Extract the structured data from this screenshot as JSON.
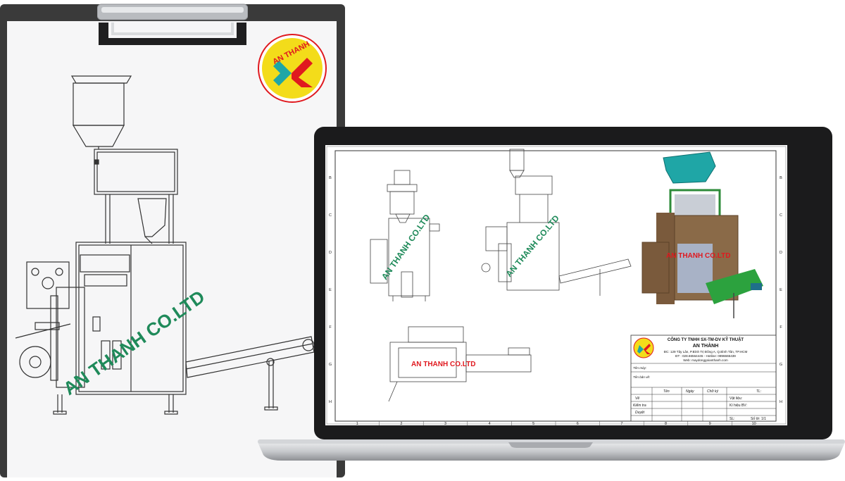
{
  "logo": {
    "text": "AN THANH"
  },
  "watermark": "AN THANH CO.LTD",
  "drawing": {
    "row_labels": [
      "B",
      "C",
      "D",
      "E",
      "F",
      "G",
      "H"
    ],
    "col_labels": [
      "1",
      "2",
      "3",
      "4",
      "5",
      "6",
      "7",
      "8",
      "9",
      "10"
    ]
  },
  "title_block": {
    "company": "CÔNG TY TNHH SX-TM-DV KỸ THUẬT",
    "company_name": "AN THÀNH",
    "address": "ĐC: 129 Tây Lân, P.Bình Trị Đông A, Q.Bình Tân, TP.HCM",
    "phone": "ĐT : 028.66564445 - Hotline: 0896665439",
    "web": "Web: maydonggoianthanh.com",
    "ten_may": "Tên máy:",
    "ten_ban_ve": "Tên bản vẽ:",
    "headers": [
      "Tên",
      "Ngày",
      "Chữ ký",
      "TL:"
    ],
    "rows": [
      "Vẽ",
      "Kiểm tra",
      "Duyệt"
    ],
    "vat_lieu": "Vật liệu:",
    "ki_hieu": "Kí hiệu BV:",
    "sl": "SL:",
    "so_to": "Số tờ: 1/1"
  },
  "colors": {
    "watermark_green": "#1f8a5a",
    "watermark_red": "#e0191f",
    "logo_yellow": "#f3dc1a",
    "hopper_teal": "#1fa6a6",
    "frame_brown": "#7a5a3c"
  }
}
